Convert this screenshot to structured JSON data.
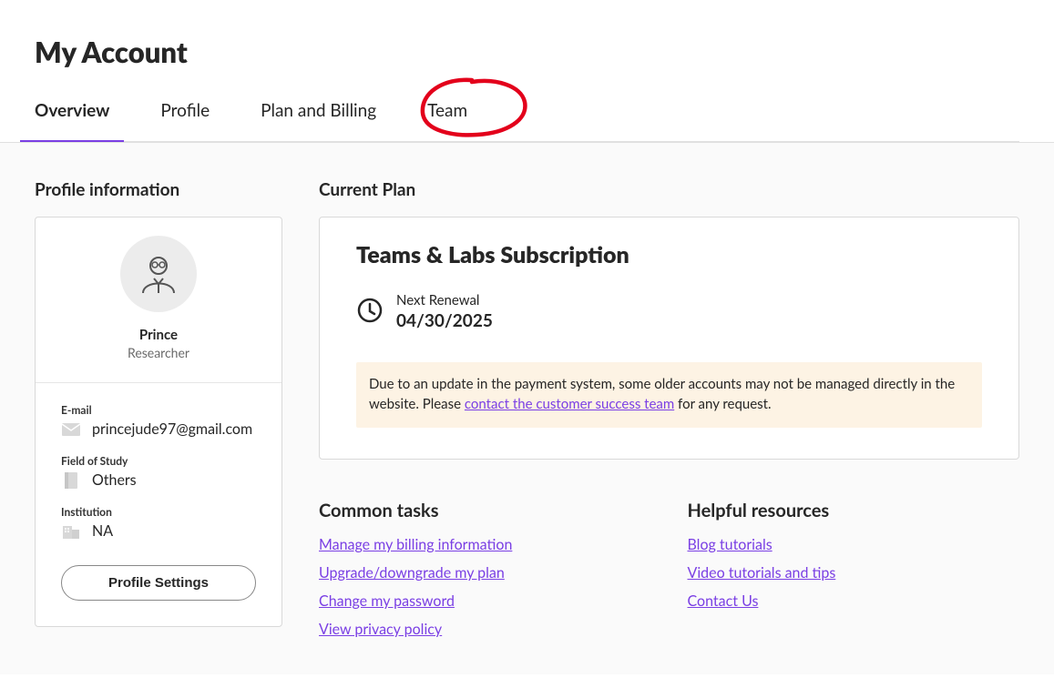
{
  "header": {
    "page_title": "My Account"
  },
  "tabs": [
    {
      "label": "Overview"
    },
    {
      "label": "Profile"
    },
    {
      "label": "Plan and Billing"
    },
    {
      "label": "Team"
    }
  ],
  "profile": {
    "section_title": "Profile information",
    "name": "Prince",
    "role": "Researcher",
    "email_label": "E-mail",
    "email_value": "princejude97@gmail.com",
    "field_of_study_label": "Field of Study",
    "field_of_study_value": "Others",
    "institution_label": "Institution",
    "institution_value": "NA",
    "settings_button": "Profile Settings"
  },
  "plan": {
    "section_title": "Current Plan",
    "plan_name": "Teams & Labs Subscription",
    "renewal_label": "Next Renewal",
    "renewal_date": "04/30/2025",
    "notice_pre": "Due to an update in the payment system, some older accounts may not be managed directly in the website. Please ",
    "notice_link": "contact the customer success team",
    "notice_post": " for any request."
  },
  "common_tasks": {
    "title": "Common tasks",
    "links": [
      "Manage my billing information",
      "Upgrade/downgrade my plan",
      "Change my password",
      "View privacy policy"
    ]
  },
  "resources": {
    "title": "Helpful resources",
    "links": [
      "Blog tutorials",
      "Video tutorials and tips",
      "Contact Us"
    ]
  }
}
